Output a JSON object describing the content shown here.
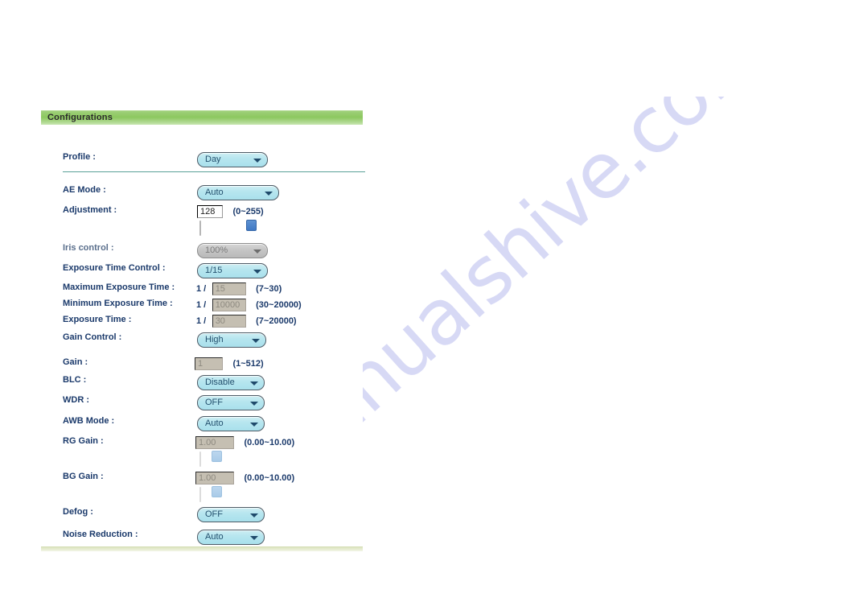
{
  "watermark": {
    "text": "manualshive.com"
  },
  "panel": {
    "header_title": "Configurations",
    "rows": {
      "profile": {
        "label": "Profile :",
        "value": "Day",
        "arrow_icon": "chevron-down-icon"
      },
      "ae_mode": {
        "label": "AE Mode :",
        "value": "Auto",
        "arrow_icon": "chevron-down-icon"
      },
      "adjustment": {
        "label": "Adjustment :",
        "value": "128",
        "hint": "(0~255)",
        "slider_percent": 50
      },
      "iris_control": {
        "label": "Iris control :",
        "value": "100%",
        "arrow_icon": "chevron-down-icon",
        "disabled": true
      },
      "exposure_time_control": {
        "label": "Exposure Time Control :",
        "value": "1/15",
        "arrow_icon": "chevron-down-icon"
      },
      "maximum_exposure_time": {
        "label": "Maximum Exposure Time :",
        "prefix": "1 /",
        "value": "15",
        "hint": "(7~30)",
        "disabled": true
      },
      "minimum_exposure_time": {
        "label": "Minimum Exposure Time :",
        "prefix": "1 /",
        "value": "10000",
        "hint": "(30~20000)",
        "disabled": true
      },
      "exposure_time": {
        "label": "Exposure Time :",
        "prefix": "1 /",
        "value": "30",
        "hint": "(7~20000)",
        "disabled": true
      },
      "gain_control": {
        "label": "Gain Control :",
        "value": "High",
        "arrow_icon": "chevron-down-icon"
      },
      "gain": {
        "label": "Gain :",
        "value": "1",
        "hint": "(1~512)",
        "disabled": true
      },
      "blc": {
        "label": "BLC :",
        "value": "Disable",
        "arrow_icon": "chevron-down-icon"
      },
      "wdr": {
        "label": "WDR :",
        "value": "OFF",
        "arrow_icon": "chevron-down-icon"
      },
      "awb_mode": {
        "label": "AWB Mode :",
        "value": "Auto",
        "arrow_icon": "chevron-down-icon"
      },
      "rg_gain": {
        "label": "RG Gain :",
        "value": "1.00",
        "hint": "(0.00~10.00)",
        "disabled": true,
        "slider_percent": 10
      },
      "bg_gain": {
        "label": "BG Gain :",
        "value": "1.00",
        "hint": "(0.00~10.00)",
        "disabled": true,
        "slider_percent": 10
      },
      "defog": {
        "label": "Defog :",
        "value": "OFF",
        "arrow_icon": "chevron-down-icon"
      },
      "noise_reduction": {
        "label": "Noise Reduction :",
        "value": "Auto",
        "arrow_icon": "chevron-down-icon"
      }
    }
  }
}
